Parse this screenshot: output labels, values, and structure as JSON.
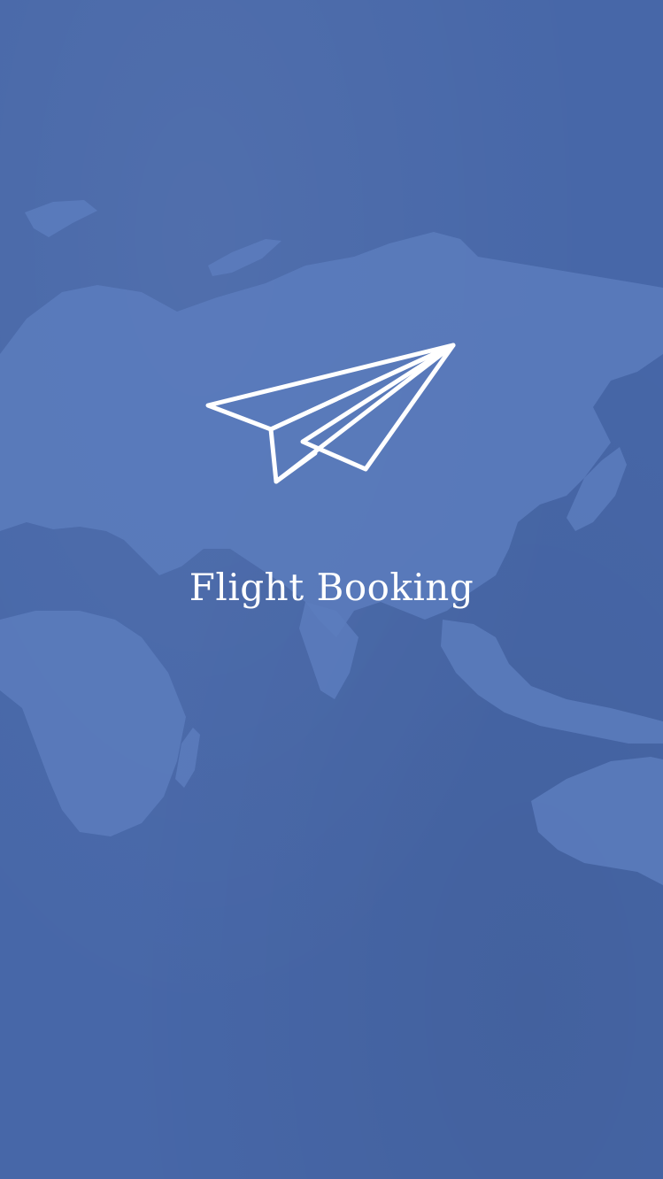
{
  "splash": {
    "title": "Flight Booking",
    "logo_icon": "paper-plane-icon",
    "background_image": "world-map",
    "colors": {
      "background": "#4767a8",
      "landmass": "#5c7cbd",
      "foreground": "#ffffff"
    }
  }
}
